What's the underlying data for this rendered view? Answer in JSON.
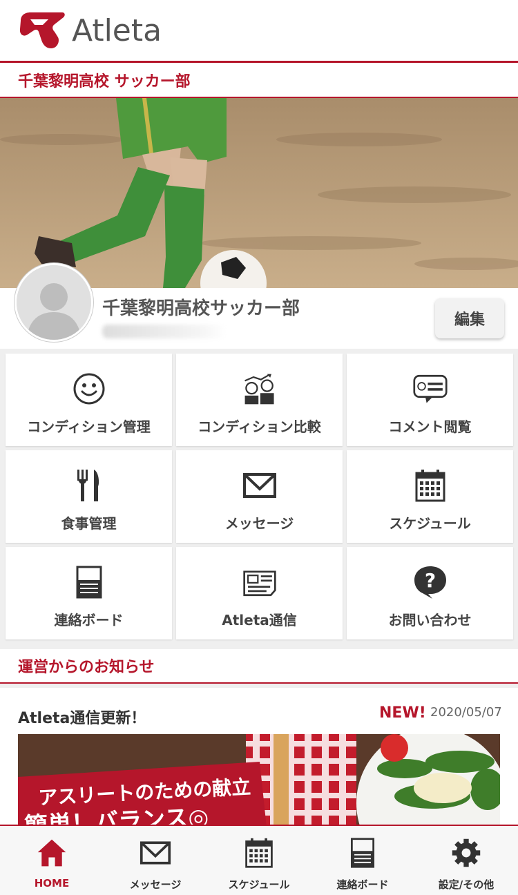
{
  "header": {
    "brand": "Atleta"
  },
  "team_bar": {
    "title": "千葉黎明高校 サッカー部"
  },
  "profile": {
    "name": "千葉黎明高校サッカー部",
    "edit_label": "編集"
  },
  "menu": [
    {
      "label": "コンディション管理",
      "icon": "smiley-icon"
    },
    {
      "label": "コンディション比較",
      "icon": "compare-people-icon"
    },
    {
      "label": "コメント閲覧",
      "icon": "comment-icon"
    },
    {
      "label": "食事管理",
      "icon": "fork-knife-icon"
    },
    {
      "label": "メッセージ",
      "icon": "envelope-icon"
    },
    {
      "label": "スケジュール",
      "icon": "calendar-icon"
    },
    {
      "label": "連絡ボード",
      "icon": "board-icon"
    },
    {
      "label": "Atleta通信",
      "icon": "newspaper-icon"
    },
    {
      "label": "お問い合わせ",
      "icon": "question-bubble-icon"
    }
  ],
  "news": {
    "section_title": "運営からのお知らせ",
    "item_title": "Atleta通信更新！",
    "badge": "NEW!",
    "date": "2020/05/07",
    "banner_line1": "アスリートのための献立",
    "banner_line2": "簡単！バランス◎"
  },
  "tabbar": [
    {
      "label": "HOME",
      "icon": "home-icon",
      "active": true
    },
    {
      "label": "メッセージ",
      "icon": "envelope-icon"
    },
    {
      "label": "スケジュール",
      "icon": "calendar-icon"
    },
    {
      "label": "連絡ボード",
      "icon": "board-icon"
    },
    {
      "label": "設定/その他",
      "icon": "gear-icon"
    }
  ],
  "colors": {
    "accent": "#b5162b",
    "text": "#333333",
    "icon": "#333333"
  }
}
